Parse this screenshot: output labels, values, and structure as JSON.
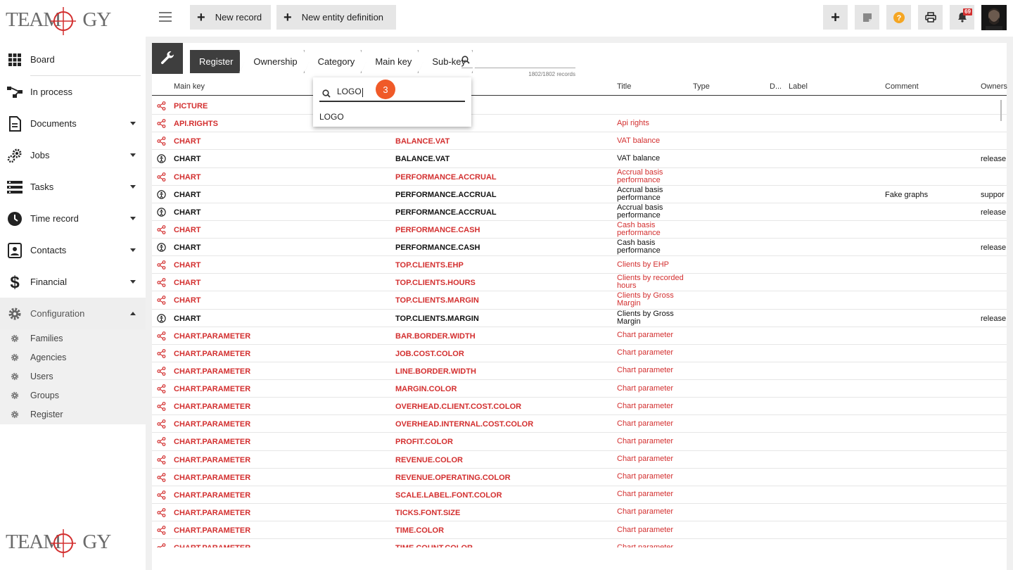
{
  "brand": {
    "logo_text": "TEAMOGY"
  },
  "sidebar": {
    "items": [
      {
        "label": "Board",
        "icon": "grid-icon"
      },
      {
        "label": "In process",
        "icon": "process-icon"
      },
      {
        "label": "Documents",
        "icon": "document-icon"
      },
      {
        "label": "Jobs",
        "icon": "gears-icon"
      },
      {
        "label": "Tasks",
        "icon": "tasks-icon"
      },
      {
        "label": "Time record",
        "icon": "clock-icon"
      },
      {
        "label": "Contacts",
        "icon": "contacts-icon"
      },
      {
        "label": "Financial",
        "icon": "dollar-icon"
      },
      {
        "label": "Configuration",
        "icon": "gear-icon"
      }
    ],
    "config_items": [
      "Families",
      "Agencies",
      "Users",
      "Groups",
      "Register"
    ]
  },
  "toolbar": {
    "new_record": "New record",
    "new_entity": "New entity definition",
    "notification_count": "69"
  },
  "breadcrumb": [
    "Register",
    "Ownership",
    "Category",
    "Main key",
    "Sub-key"
  ],
  "search": {
    "count": "1802/1802 records"
  },
  "table": {
    "headers": {
      "main_key": "Main key",
      "title": "Title",
      "type": "Type",
      "d": "D...",
      "label": "Label",
      "comment": "Comment",
      "owners": "Owners"
    },
    "rows": [
      {
        "kind": "shared",
        "main": "PICTURE",
        "sub": "",
        "title": "",
        "comment": "",
        "owner": ""
      },
      {
        "kind": "shared",
        "main": "API.RIGHTS",
        "sub": "",
        "title": "Api rights",
        "comment": "",
        "owner": ""
      },
      {
        "kind": "shared",
        "main": "CHART",
        "sub": "BALANCE.VAT",
        "title": "VAT balance",
        "comment": "",
        "owner": ""
      },
      {
        "kind": "own",
        "main": "CHART",
        "sub": "BALANCE.VAT",
        "title": "VAT balance",
        "comment": "",
        "owner": "release"
      },
      {
        "kind": "shared",
        "main": "CHART",
        "sub": "PERFORMANCE.ACCRUAL",
        "title": "Accrual basis performance",
        "comment": "",
        "owner": ""
      },
      {
        "kind": "own",
        "main": "CHART",
        "sub": "PERFORMANCE.ACCRUAL",
        "title": "Accrual basis performance",
        "comment": "Fake graphs",
        "owner": "suppor"
      },
      {
        "kind": "own",
        "main": "CHART",
        "sub": "PERFORMANCE.ACCRUAL",
        "title": "Accrual basis performance",
        "comment": "",
        "owner": "release"
      },
      {
        "kind": "shared",
        "main": "CHART",
        "sub": "PERFORMANCE.CASH",
        "title": "Cash basis performance",
        "comment": "",
        "owner": ""
      },
      {
        "kind": "own",
        "main": "CHART",
        "sub": "PERFORMANCE.CASH",
        "title": "Cash basis performance",
        "comment": "",
        "owner": "release"
      },
      {
        "kind": "shared",
        "main": "CHART",
        "sub": "TOP.CLIENTS.EHP",
        "title": "Clients by EHP",
        "comment": "",
        "owner": ""
      },
      {
        "kind": "shared",
        "main": "CHART",
        "sub": "TOP.CLIENTS.HOURS",
        "title": "Clients by recorded hours",
        "comment": "",
        "owner": ""
      },
      {
        "kind": "shared",
        "main": "CHART",
        "sub": "TOP.CLIENTS.MARGIN",
        "title": "Clients by Gross Margin",
        "comment": "",
        "owner": ""
      },
      {
        "kind": "own",
        "main": "CHART",
        "sub": "TOP.CLIENTS.MARGIN",
        "title": "Clients by Gross Margin",
        "comment": "",
        "owner": "release"
      },
      {
        "kind": "shared",
        "main": "CHART.PARAMETER",
        "sub": "BAR.BORDER.WIDTH",
        "title": "Chart parameter",
        "comment": "",
        "owner": ""
      },
      {
        "kind": "shared",
        "main": "CHART.PARAMETER",
        "sub": "JOB.COST.COLOR",
        "title": "Chart parameter",
        "comment": "",
        "owner": ""
      },
      {
        "kind": "shared",
        "main": "CHART.PARAMETER",
        "sub": "LINE.BORDER.WIDTH",
        "title": "Chart parameter",
        "comment": "",
        "owner": ""
      },
      {
        "kind": "shared",
        "main": "CHART.PARAMETER",
        "sub": "MARGIN.COLOR",
        "title": "Chart parameter",
        "comment": "",
        "owner": ""
      },
      {
        "kind": "shared",
        "main": "CHART.PARAMETER",
        "sub": "OVERHEAD.CLIENT.COST.COLOR",
        "title": "Chart parameter",
        "comment": "",
        "owner": ""
      },
      {
        "kind": "shared",
        "main": "CHART.PARAMETER",
        "sub": "OVERHEAD.INTERNAL.COST.COLOR",
        "title": "Chart parameter",
        "comment": "",
        "owner": ""
      },
      {
        "kind": "shared",
        "main": "CHART.PARAMETER",
        "sub": "PROFIT.COLOR",
        "title": "Chart parameter",
        "comment": "",
        "owner": ""
      },
      {
        "kind": "shared",
        "main": "CHART.PARAMETER",
        "sub": "REVENUE.COLOR",
        "title": "Chart parameter",
        "comment": "",
        "owner": ""
      },
      {
        "kind": "shared",
        "main": "CHART.PARAMETER",
        "sub": "REVENUE.OPERATING.COLOR",
        "title": "Chart parameter",
        "comment": "",
        "owner": ""
      },
      {
        "kind": "shared",
        "main": "CHART.PARAMETER",
        "sub": "SCALE.LABEL.FONT.COLOR",
        "title": "Chart parameter",
        "comment": "",
        "owner": ""
      },
      {
        "kind": "shared",
        "main": "CHART.PARAMETER",
        "sub": "TICKS.FONT.SIZE",
        "title": "Chart parameter",
        "comment": "",
        "owner": ""
      },
      {
        "kind": "shared",
        "main": "CHART.PARAMETER",
        "sub": "TIME.COLOR",
        "title": "Chart parameter",
        "comment": "",
        "owner": ""
      },
      {
        "kind": "shared",
        "main": "CHART.PARAMETER",
        "sub": "TIME.COUNT.COLOR",
        "title": "Chart parameter",
        "comment": "",
        "owner": ""
      }
    ]
  },
  "popup": {
    "query": "LOGO",
    "option": "LOGO",
    "step": "3"
  },
  "colors": {
    "accent": "#d32f2f",
    "step": "#f05a28",
    "dark": "#3e3e3e",
    "help": "#f5a623"
  }
}
